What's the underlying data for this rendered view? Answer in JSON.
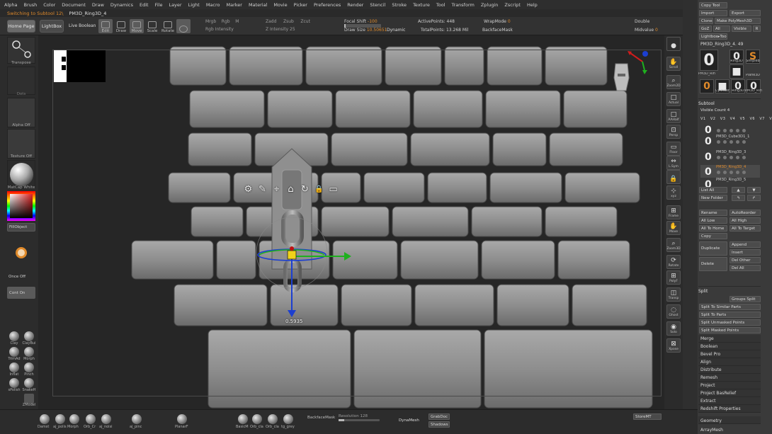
{
  "menu": [
    "Alpha",
    "Brush",
    "Color",
    "Document",
    "Draw",
    "Dynamics",
    "Edit",
    "File",
    "Layer",
    "Light",
    "Macro",
    "Marker",
    "Material",
    "Movie",
    "Picker",
    "Preferences",
    "Render",
    "Stencil",
    "Stroke",
    "Texture",
    "Tool",
    "Transform",
    "Zplugin",
    "Zscript",
    "Help"
  ],
  "notice": {
    "switching": "Switching to Subtool 12\\",
    "tool_name": "PM3D_Ring3D_4"
  },
  "toolbar": {
    "home_page": "Home Page",
    "lightbox": "LightBox",
    "live_boolean": "Live Boolean",
    "edit": "Edit",
    "draw": "Draw",
    "move": "Move",
    "scale": "Scale",
    "rotate": "Rotate",
    "rgb_row": [
      "Mrgb",
      "Rgb",
      "M"
    ],
    "zadd_row": [
      "Zadd",
      "Zsub",
      "Zcut"
    ],
    "rgb_intensity": "Rgb Intensity",
    "z_intensity": "Z Intensity 25",
    "focal_shift_label": "Focal Shift",
    "focal_shift_value": "-100",
    "draw_size_label": "Draw Size",
    "draw_size_value": "10.50651",
    "dynamic": "Dynamic",
    "active_points": "ActivePoints: 448",
    "total_points": "TotalPoints: 13.268 Mil",
    "wrap_mode_label": "WrapMode",
    "wrap_mode_value": "0",
    "backface_mask": "BackfaceMask",
    "double": "Double",
    "midvalue_label": "Midvalue",
    "midvalue_value": "0"
  },
  "left_shelf": {
    "transpose": "Transpose",
    "dots": "Dots",
    "alpha_off": "Alpha Off",
    "texture_off": "Texture Off",
    "matcap": "MatCap White",
    "fill_object": "FillObject",
    "once_off": "Once Off",
    "cont_on": "Cont On",
    "brushes": [
      {
        "a": "Clay",
        "b": "ClayBui"
      },
      {
        "a": "TrimAd",
        "b": "Morph"
      },
      {
        "a": "Inflat",
        "b": "Pinch"
      },
      {
        "a": "sPolish",
        "b": "SnakeH"
      }
    ],
    "zmodeler": "ZModel",
    "bottom_brushes": [
      "Morph",
      "Orb_Cr"
    ]
  },
  "viewport": {
    "gizmo_value": "0.5935",
    "icons": [
      "gear-icon",
      "pin-icon",
      "location-icon",
      "home-icon",
      "reset-icon",
      "lock-icon",
      "mask-icon"
    ],
    "icon_glyphs": [
      "⚙",
      "✎",
      "⌖",
      "⌂",
      "↻",
      "🔒",
      "▭"
    ]
  },
  "right_shelf": [
    {
      "label": "",
      "glyph": "●"
    },
    {
      "label": "Scroll",
      "glyph": "✋"
    },
    {
      "label": "Zoom2D",
      "glyph": "⌕"
    },
    {
      "label": "Actual",
      "glyph": "□"
    },
    {
      "label": "AAHalf",
      "glyph": "□"
    },
    {
      "label": "Persp",
      "glyph": "⊡"
    },
    {
      "label": "Floor",
      "glyph": "▭"
    },
    {
      "label": "L.Sym",
      "glyph": "⇔"
    },
    {
      "label": "",
      "glyph": "🔒"
    },
    {
      "label": "xyz",
      "glyph": "⊹"
    },
    {
      "label": "Frame",
      "glyph": "⊞"
    },
    {
      "label": "Move",
      "glyph": "✋"
    },
    {
      "label": "Zoom3D",
      "glyph": "⌕"
    },
    {
      "label": "Rotate",
      "glyph": "⟳"
    },
    {
      "label": "PolyF",
      "glyph": "⊞"
    },
    {
      "label": "Transp",
      "glyph": "◫"
    },
    {
      "label": "Ghost",
      "glyph": "◌"
    },
    {
      "label": "Solo",
      "glyph": "◉"
    },
    {
      "label": "Xpose",
      "glyph": "⊠"
    }
  ],
  "tray": {
    "copy_tool": "Copy Tool",
    "import": "Import",
    "export": "Export",
    "clone": "Clone",
    "make_polymesh": "Make PolyMesh3D",
    "goz": "GoZ",
    "all": "All",
    "visible": "Visible",
    "r": "R",
    "lightbox_tools": "Lightbox▸Tools",
    "current_tool": "PM3D_Ring3D_4. 49",
    "tool_thumbs": [
      {
        "glyph": "0",
        "label": "PM3D_Ring3D"
      },
      {
        "glyph": "0",
        "label": "Ring3D"
      },
      {
        "glyph": "S",
        "label": "SimpleB"
      },
      {
        "glyph": "■",
        "label": "Plane3D"
      },
      {
        "glyph": "0",
        "label": "PM3D_Ring3D"
      },
      {
        "glyph": "■",
        "label": "Cylinder"
      },
      {
        "glyph": "0",
        "label": "Ring3D"
      },
      {
        "glyph": "0",
        "label": "PM3D_Ring3D"
      }
    ],
    "subtool_title": "Subtool",
    "visible_count": "Visible Count 4",
    "v_labels": [
      "V1",
      "V2",
      "V3",
      "V4",
      "V5",
      "V6",
      "V7",
      "V8"
    ],
    "subtools": [
      {
        "name": "",
        "active": false
      },
      {
        "name": "PM3D_Cube3D1_1",
        "active": false
      },
      {
        "name": "PM3D_Ring3D_3",
        "active": false
      },
      {
        "name": "PM3D_Ring3D_4",
        "active": true
      },
      {
        "name": "PM3D_Ring3D_5",
        "active": false
      }
    ],
    "list_all": "List All",
    "new_folder": "New Folder",
    "rename": "Rename",
    "auto_reorder": "AutoReorder",
    "all_low": "All Low",
    "all_high": "All High",
    "all_to_home": "All To Home",
    "all_to_target": "All To Target",
    "copy": "Copy",
    "duplicate": "Duplicate",
    "append": "Append",
    "insert": "Insert",
    "delete": "Delete",
    "del_other": "Del Other",
    "del_all": "Del All",
    "split_title": "Split",
    "groups_split": "Groups Split",
    "split_similar": "Split To Similar Parts",
    "split_parts": "Split To Parts",
    "split_unmasked": "Split Unmasked Points",
    "split_masked": "Split Masked Points",
    "sections": [
      "Merge",
      "Boolean",
      "Bevel Pro",
      "Align",
      "Distribute",
      "Remesh",
      "Project",
      "Project BasRelief",
      "Extract",
      "Redshift Properties"
    ],
    "geometry": "Geometry",
    "array_mesh": "ArrayMesh"
  },
  "bottom": {
    "balls": [
      "Damst",
      "aj_polis",
      "Morph",
      "Orb_Cr",
      "aj_noisi",
      "aj_pinc",
      "PlanarF",
      "BasicM",
      "Orb_cla",
      "Orb_cla",
      "tg_grey"
    ],
    "backface_mask": "BackfaceMask",
    "resolution": "Resolution 128",
    "dynamesh": "DynaMesh",
    "groups": "GrabDoc",
    "shadows": "Shadows",
    "store_mt": "StoreMT"
  }
}
